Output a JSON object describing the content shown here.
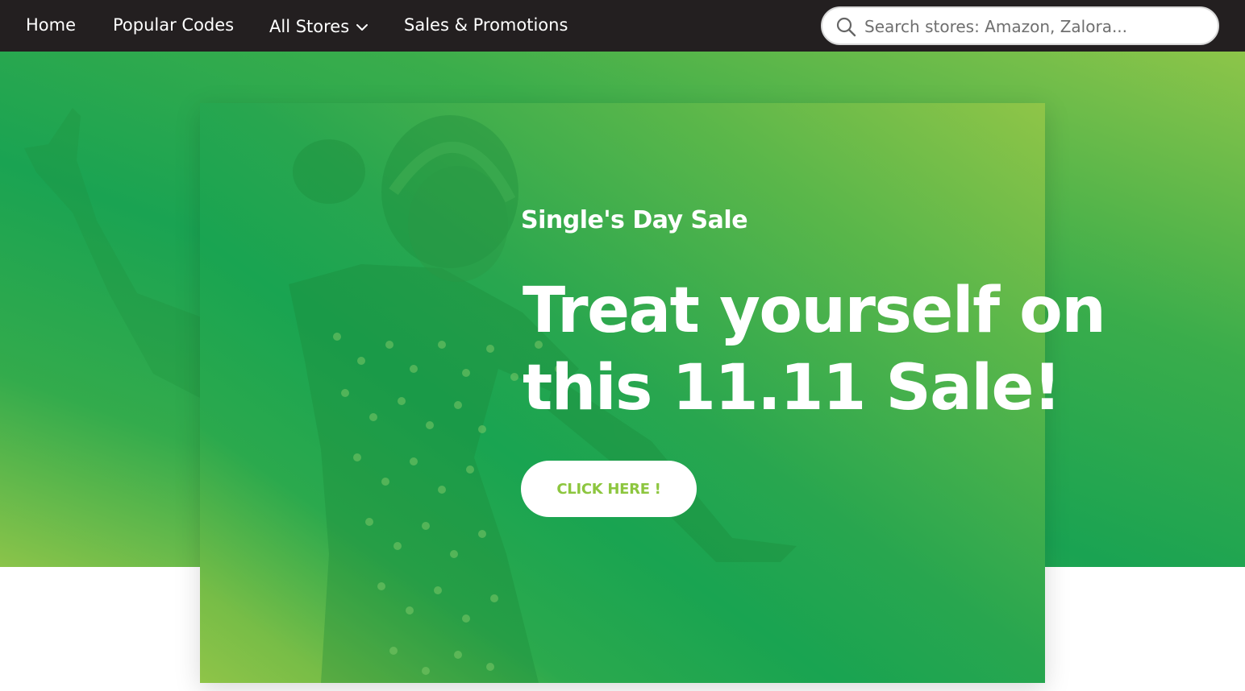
{
  "nav": {
    "items": [
      {
        "label": "Home"
      },
      {
        "label": "Popular Codes"
      },
      {
        "label": "All Stores"
      },
      {
        "label": "Sales & Promotions"
      }
    ],
    "search_placeholder": "Search stores: Amazon, Zalora..."
  },
  "hero": {
    "eyebrow": "Single's Day Sale",
    "headline": "Treat yourself on this 11.11 Sale!",
    "cta_label": "CLICK HERE !"
  },
  "colors": {
    "nav_bg": "#231f20",
    "brand_green": "#1aa352",
    "lime": "#8dc63f",
    "white": "#ffffff"
  },
  "icons": [
    "chevron-down-icon",
    "search-icon"
  ]
}
